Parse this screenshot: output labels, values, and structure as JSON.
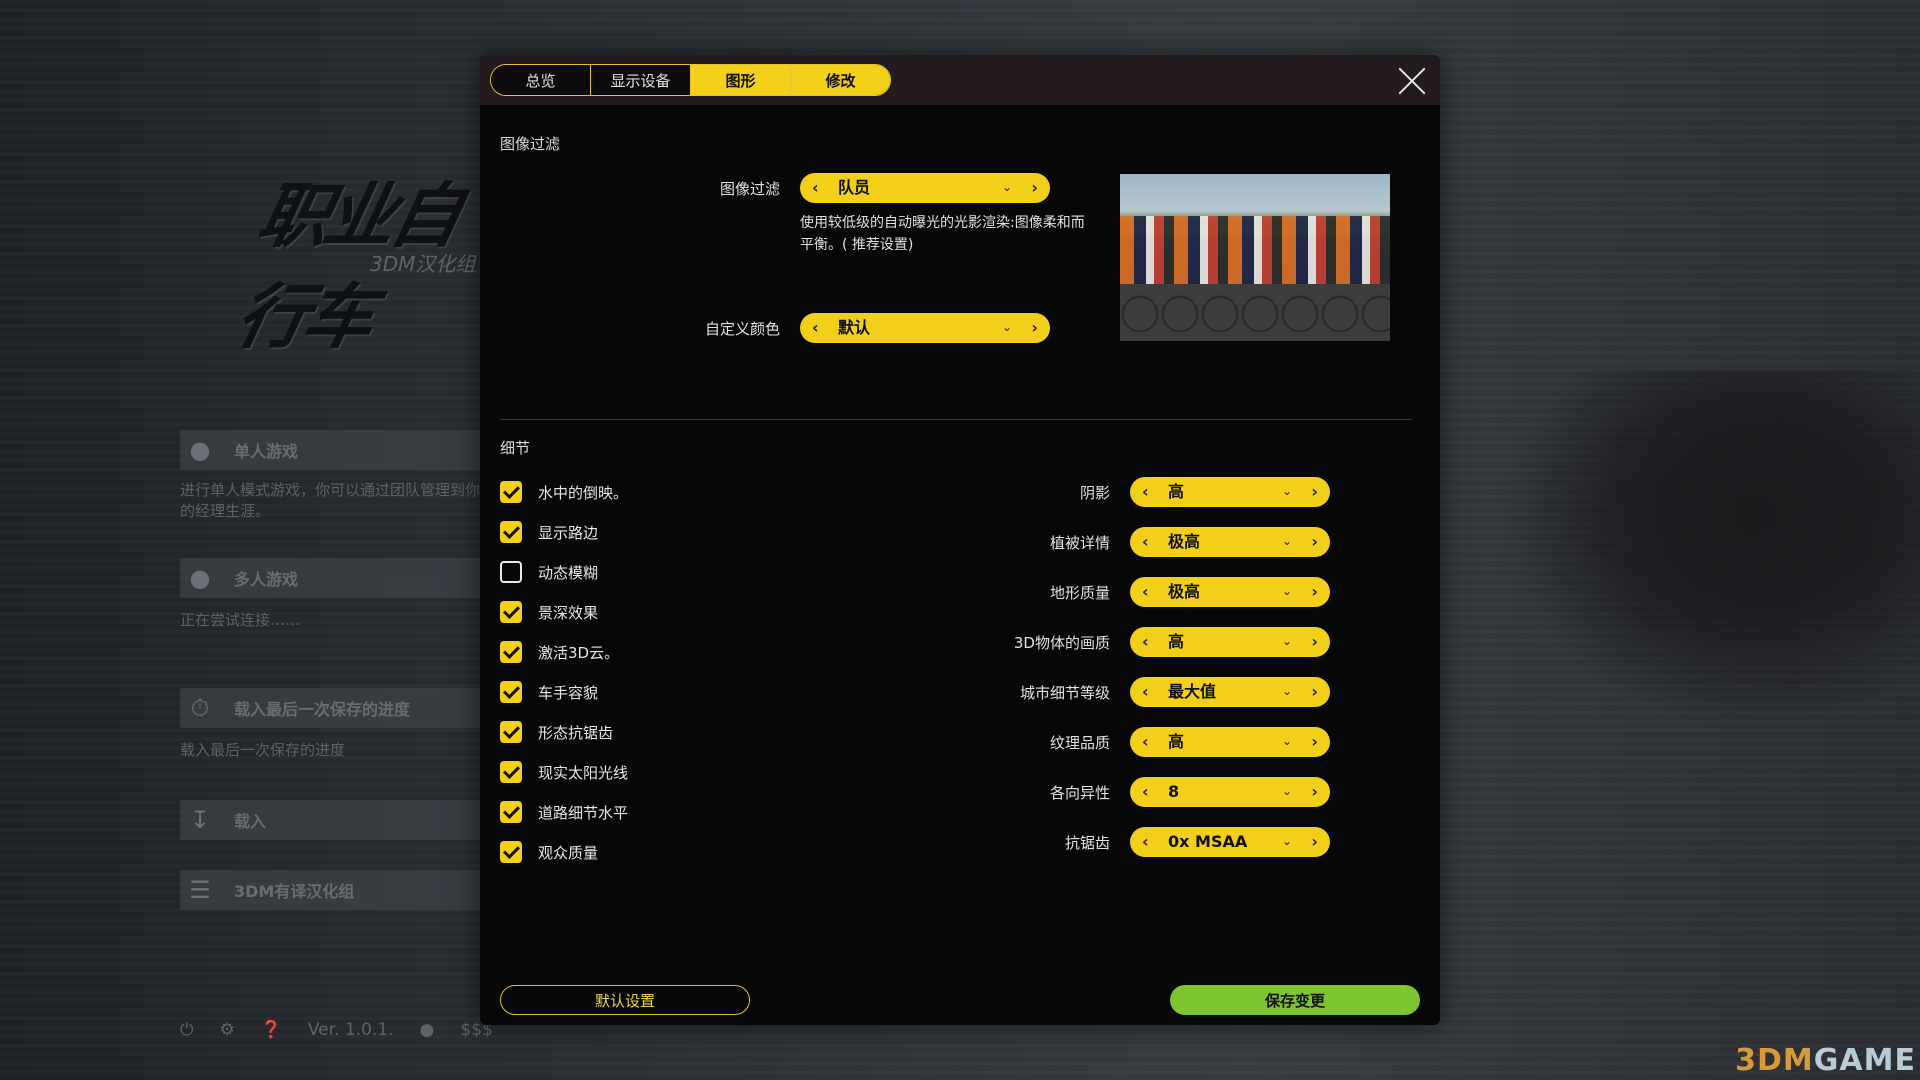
{
  "background": {
    "logo_main": "职业自行车",
    "logo_sub": "3DM汉化组",
    "menu": [
      {
        "icon": "person-icon",
        "label": "单人游戏"
      },
      {
        "icon": "group-icon",
        "label": "多人游戏"
      },
      {
        "icon": "stopwatch-icon",
        "label": "载入最后一次保存的进度"
      },
      {
        "icon": "download-icon",
        "label": "载入"
      },
      {
        "icon": "list-icon",
        "label": "3DM有译汉化组"
      }
    ],
    "menu_desc_1": "进行单人模式游戏，你可以通过团队管理到你的经理生涯。",
    "menu_desc_2": "正在尝试连接……",
    "menu_desc_3": "载入最后一次保存的进度",
    "version": "Ver. 1.0.1.",
    "currency": "$$$",
    "watermark_prefix": "3DM",
    "watermark_suffix": "GAME"
  },
  "dialog": {
    "tabs": [
      "总览",
      "显示设备",
      "图形",
      "修改"
    ],
    "active_tabs": [
      2,
      3
    ],
    "image_filter": {
      "section_title": "图像过滤",
      "filter_label": "图像过滤",
      "filter_value": "队员",
      "description": "使用较低级的自动曝光的光影渲染:图像柔和而平衡。( 推荐设置)",
      "color_label": "自定义颜色",
      "color_value": "默认"
    },
    "details": {
      "section_title": "细节",
      "checkboxes": [
        {
          "label": "水中的倒映。",
          "checked": true
        },
        {
          "label": "显示路边",
          "checked": true
        },
        {
          "label": "动态模糊",
          "checked": false
        },
        {
          "label": "景深效果",
          "checked": true
        },
        {
          "label": "激活3D云。",
          "checked": true
        },
        {
          "label": "车手容貌",
          "checked": true
        },
        {
          "label": "形态抗锯齿",
          "checked": true
        },
        {
          "label": "现实太阳光线",
          "checked": true
        },
        {
          "label": "道路细节水平",
          "checked": true
        },
        {
          "label": "观众质量",
          "checked": true
        }
      ],
      "settings": [
        {
          "label": "阴影",
          "value": "高"
        },
        {
          "label": "植被详情",
          "value": "极高"
        },
        {
          "label": "地形质量",
          "value": "极高"
        },
        {
          "label": "3D物体的画质",
          "value": "高"
        },
        {
          "label": "城市细节等级",
          "value": "最大值"
        },
        {
          "label": "纹理品质",
          "value": "高"
        },
        {
          "label": "各向异性",
          "value": "8"
        },
        {
          "label": "抗锯齿",
          "value": "0x MSAA"
        }
      ]
    },
    "buttons": {
      "defaults": "默认设置",
      "save": "保存变更"
    }
  },
  "colors": {
    "accent_yellow": "#f2cf19",
    "save_green": "#7ec431",
    "dialog_bg": "#070707"
  }
}
